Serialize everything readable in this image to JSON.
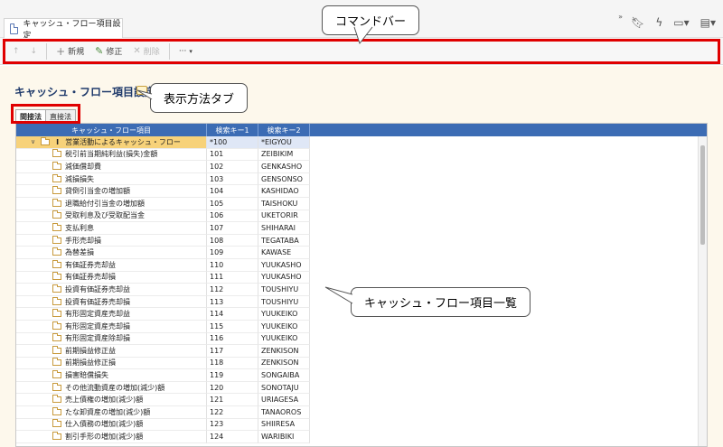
{
  "tab": {
    "title": "キャッシュ・フロー項目設定"
  },
  "toolbar": {
    "up_label": "↑",
    "down_label": "↓",
    "new_label": "新規",
    "edit_label": "修正",
    "delete_label": "削除",
    "more_label": "···"
  },
  "page": {
    "title": "キャッシュ・フロー項目設定"
  },
  "view_tabs": [
    {
      "label": "間接法"
    },
    {
      "label": "直接法"
    }
  ],
  "grid": {
    "headers": [
      "キャッシュ・フロー項目",
      "検索キー1",
      "検索キー2"
    ],
    "root": {
      "num": "I",
      "name": "営業活動によるキャッシュ・フロー",
      "key1": "*100",
      "key2": "*EIGYOU"
    },
    "rows": [
      {
        "name": "税引前当期純利益(損失)金額",
        "key1": "101",
        "key2": "ZEIBIKIM"
      },
      {
        "name": "減価償却費",
        "key1": "102",
        "key2": "GENKASHO"
      },
      {
        "name": "減損損失",
        "key1": "103",
        "key2": "GENSONSO"
      },
      {
        "name": "貸倒引当金の増加額",
        "key1": "104",
        "key2": "KASHIDAO"
      },
      {
        "name": "退職給付引当金の増加額",
        "key1": "105",
        "key2": "TAISHOKU"
      },
      {
        "name": "受取利息及び受取配当金",
        "key1": "106",
        "key2": "UKETORIR"
      },
      {
        "name": "支払利息",
        "key1": "107",
        "key2": "SHIHARAI"
      },
      {
        "name": "手形売却損",
        "key1": "108",
        "key2": "TEGATABA"
      },
      {
        "name": "為替差損",
        "key1": "109",
        "key2": "KAWASE"
      },
      {
        "name": "有価証券売却益",
        "key1": "110",
        "key2": "YUUKASHO"
      },
      {
        "name": "有価証券売却損",
        "key1": "111",
        "key2": "YUUKASHO"
      },
      {
        "name": "投資有価証券売却益",
        "key1": "112",
        "key2": "TOUSHIYU"
      },
      {
        "name": "投資有価証券売却損",
        "key1": "113",
        "key2": "TOUSHIYU"
      },
      {
        "name": "有形固定資産売却益",
        "key1": "114",
        "key2": "YUUKEIKO"
      },
      {
        "name": "有形固定資産売却損",
        "key1": "115",
        "key2": "YUUKEIKO"
      },
      {
        "name": "有形固定資産除却損",
        "key1": "116",
        "key2": "YUUKEIKO"
      },
      {
        "name": "前期損益修正益",
        "key1": "117",
        "key2": "ZENKISON"
      },
      {
        "name": "前期損益修正損",
        "key1": "118",
        "key2": "ZENKISON"
      },
      {
        "name": "損害賠償損失",
        "key1": "119",
        "key2": "SONGAIBA"
      },
      {
        "name": "その他流動資産の増加(減少)額",
        "key1": "120",
        "key2": "SONOTAJU"
      },
      {
        "name": "売上債権の増加(減少)額",
        "key1": "121",
        "key2": "URIAGESA"
      },
      {
        "name": "たな卸資産の増加(減少)額",
        "key1": "122",
        "key2": "TANAOROS"
      },
      {
        "name": "仕入債務の増加(減少)額",
        "key1": "123",
        "key2": "SHIIRESA"
      },
      {
        "name": "割引手形の増加(減少)額",
        "key1": "124",
        "key2": "WARIBIKI"
      }
    ]
  },
  "callouts": {
    "command_bar": "コマンドバー",
    "view_tabs": "表示方法タブ",
    "item_list": "キャッシュ・フロー項目一覧"
  }
}
